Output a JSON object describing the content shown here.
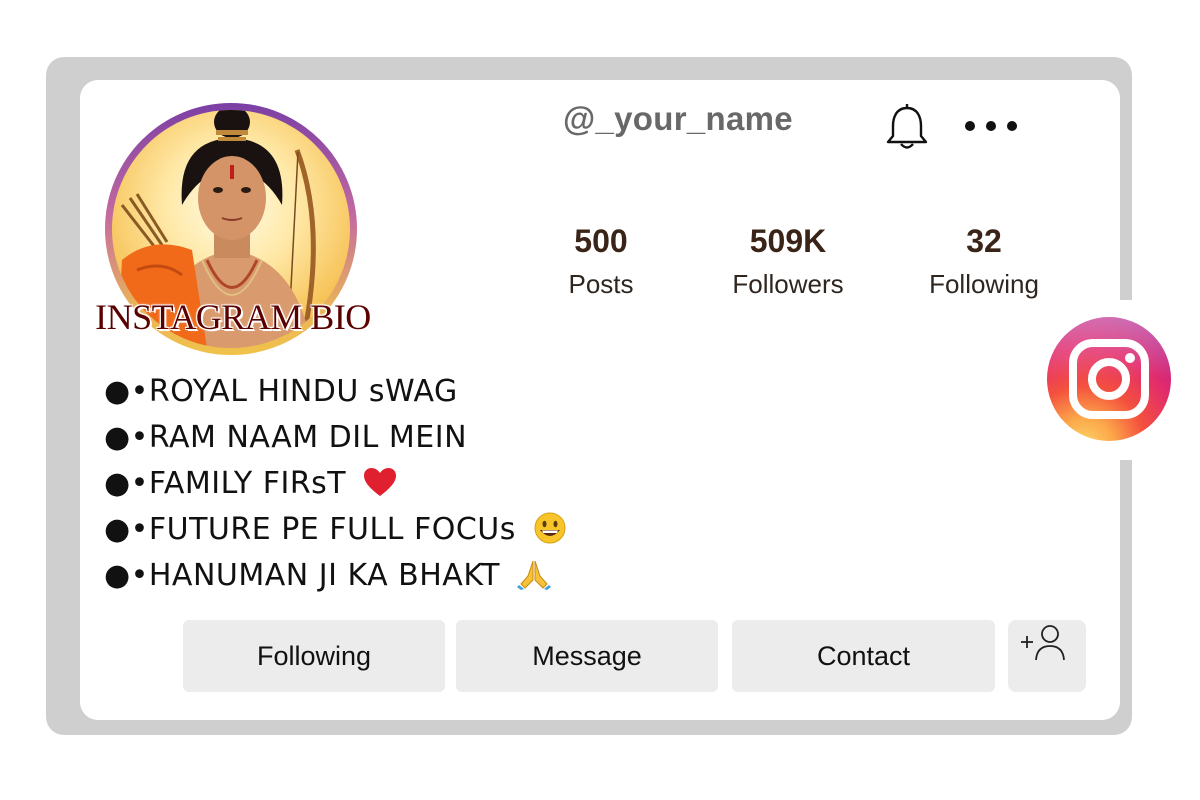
{
  "profile": {
    "username": "@_your_name",
    "avatar_caption": "INSTAGRAM BIO"
  },
  "stats": [
    {
      "value": "500",
      "label": "Posts"
    },
    {
      "value": "509K",
      "label": "Followers"
    },
    {
      "value": "32",
      "label": "Following"
    }
  ],
  "bio": [
    {
      "text": "●•ROYAL HINDU sWAG",
      "emoji": ""
    },
    {
      "text": "●•RAM NAAM DIL MEIN",
      "emoji": ""
    },
    {
      "text": "●•FAMILY FIRsT",
      "emoji": "red-heart"
    },
    {
      "text": "●•FUTURE PE FULL FOCUs",
      "emoji": "grinning-face"
    },
    {
      "text": "●•HANUMAN JI KA BHAKT",
      "emoji": "folded-hands"
    }
  ],
  "actions": {
    "following_label": "Following",
    "message_label": "Message",
    "contact_label": "Contact"
  },
  "icons": {
    "notifications": "bell-icon",
    "more": "more-options-icon",
    "add_user": "add-user-icon",
    "brand": "instagram-logo"
  },
  "colors": {
    "frame": "#cfcfcf",
    "button_bg": "#ececec",
    "stat_text": "#3a2418",
    "caption": "#5a0000"
  }
}
